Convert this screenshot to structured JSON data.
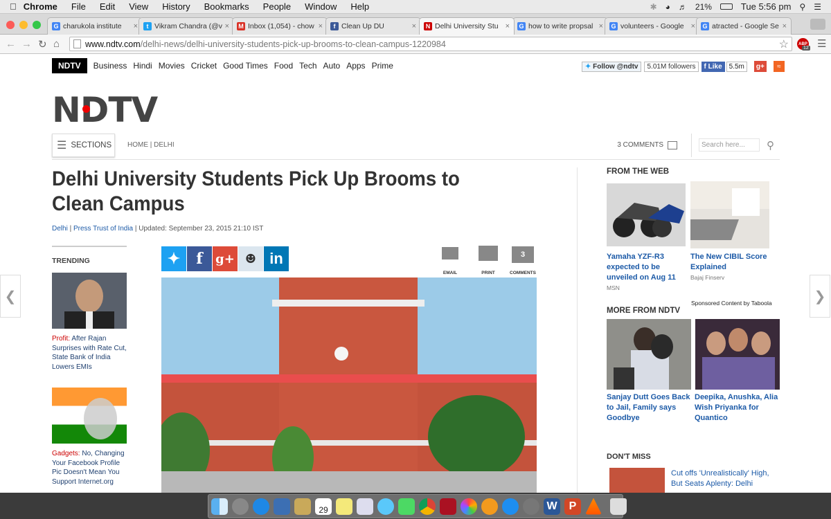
{
  "menubar": {
    "apple": "",
    "app": "Chrome",
    "items": [
      "File",
      "Edit",
      "View",
      "History",
      "Bookmarks",
      "People",
      "Window",
      "Help"
    ],
    "battery": "21%",
    "clock": "Tue 5:56 pm"
  },
  "tabs": [
    {
      "title": "charukola institute",
      "favicon": "google-icon",
      "color": "#4285f4",
      "letter": "G"
    },
    {
      "title": "Vikram Chandra (@v",
      "favicon": "twitter-icon",
      "color": "#1da1f2",
      "letter": "t"
    },
    {
      "title": "Inbox (1,054) - chow",
      "favicon": "gmail-icon",
      "color": "#d93025",
      "letter": "M"
    },
    {
      "title": "Clean Up DU",
      "favicon": "facebook-icon",
      "color": "#3b5998",
      "letter": "f"
    },
    {
      "title": "Delhi University Stu",
      "favicon": "ndtv-icon",
      "color": "#c00",
      "letter": "N"
    },
    {
      "title": "how to write propsal",
      "favicon": "google-icon",
      "color": "#4285f4",
      "letter": "G"
    },
    {
      "title": "volunteers - Google",
      "favicon": "google-icon",
      "color": "#4285f4",
      "letter": "G"
    },
    {
      "title": "atracted - Google Se",
      "favicon": "google-icon",
      "color": "#4285f4",
      "letter": "G"
    }
  ],
  "url": {
    "domain": "www.ndtv.com",
    "path": "/delhi-news/delhi-university-students-pick-up-brooms-to-clean-campus-1220984"
  },
  "abp_count": "12",
  "nav": {
    "logo": "NDTV",
    "links": [
      "Business",
      "Hindi",
      "Movies",
      "Cricket",
      "Good Times",
      "Food",
      "Tech",
      "Auto",
      "Apps",
      "Prime"
    ]
  },
  "social": {
    "follow": "Follow @ndtv",
    "followers": "5.01M followers",
    "like": "Like",
    "likes": "5.5m"
  },
  "big_logo": "NDTV",
  "sections_label": "SECTIONS",
  "breadcrumb": "HOME | DELHI",
  "comments_link": "3 COMMENTS",
  "search_placeholder": "Search here...",
  "article": {
    "headline": "Delhi University Students Pick Up Brooms to Clean Campus",
    "byline_section": "Delhi",
    "byline_source": "Press Trust of India",
    "byline_updated": " | Updated: September 23, 2015 21:10 IST"
  },
  "trending": {
    "heading": "TRENDING",
    "items": [
      {
        "kicker": "Profit:",
        "text": " After Rajan Surprises with Rate Cut, State Bank of India Lowers EMIs"
      },
      {
        "kicker": "Gadgets:",
        "text": " No, Changing Your Facebook Profile Pic Doesn't Mean You Support Internet.org"
      }
    ]
  },
  "actions": {
    "email": "EMAIL",
    "print": "PRINT",
    "comments": "COMMENTS",
    "comment_count": "3"
  },
  "from_web": {
    "heading": "FROM THE WEB",
    "items": [
      {
        "title": "Yamaha YZF-R3 expected to be unveiled on Aug 11",
        "source": "MSN"
      },
      {
        "title": "The New CIBIL Score Explained",
        "source": "Bajaj Finserv"
      }
    ],
    "sponsored": "Sponsored Content by Taboola"
  },
  "more_from": {
    "heading": "MORE FROM NDTV",
    "items": [
      {
        "title": "Sanjay Dutt Goes Back to Jail, Family says Goodbye"
      },
      {
        "title": "Deepika, Anushka, Alia Wish Priyanka for Quantico"
      }
    ]
  },
  "dont_miss": {
    "heading": "DON'T MISS",
    "item": "Cut offs 'Unrealistically' High, But Seats Aplenty: Delhi"
  },
  "dock": {
    "calendar_day": "29"
  }
}
